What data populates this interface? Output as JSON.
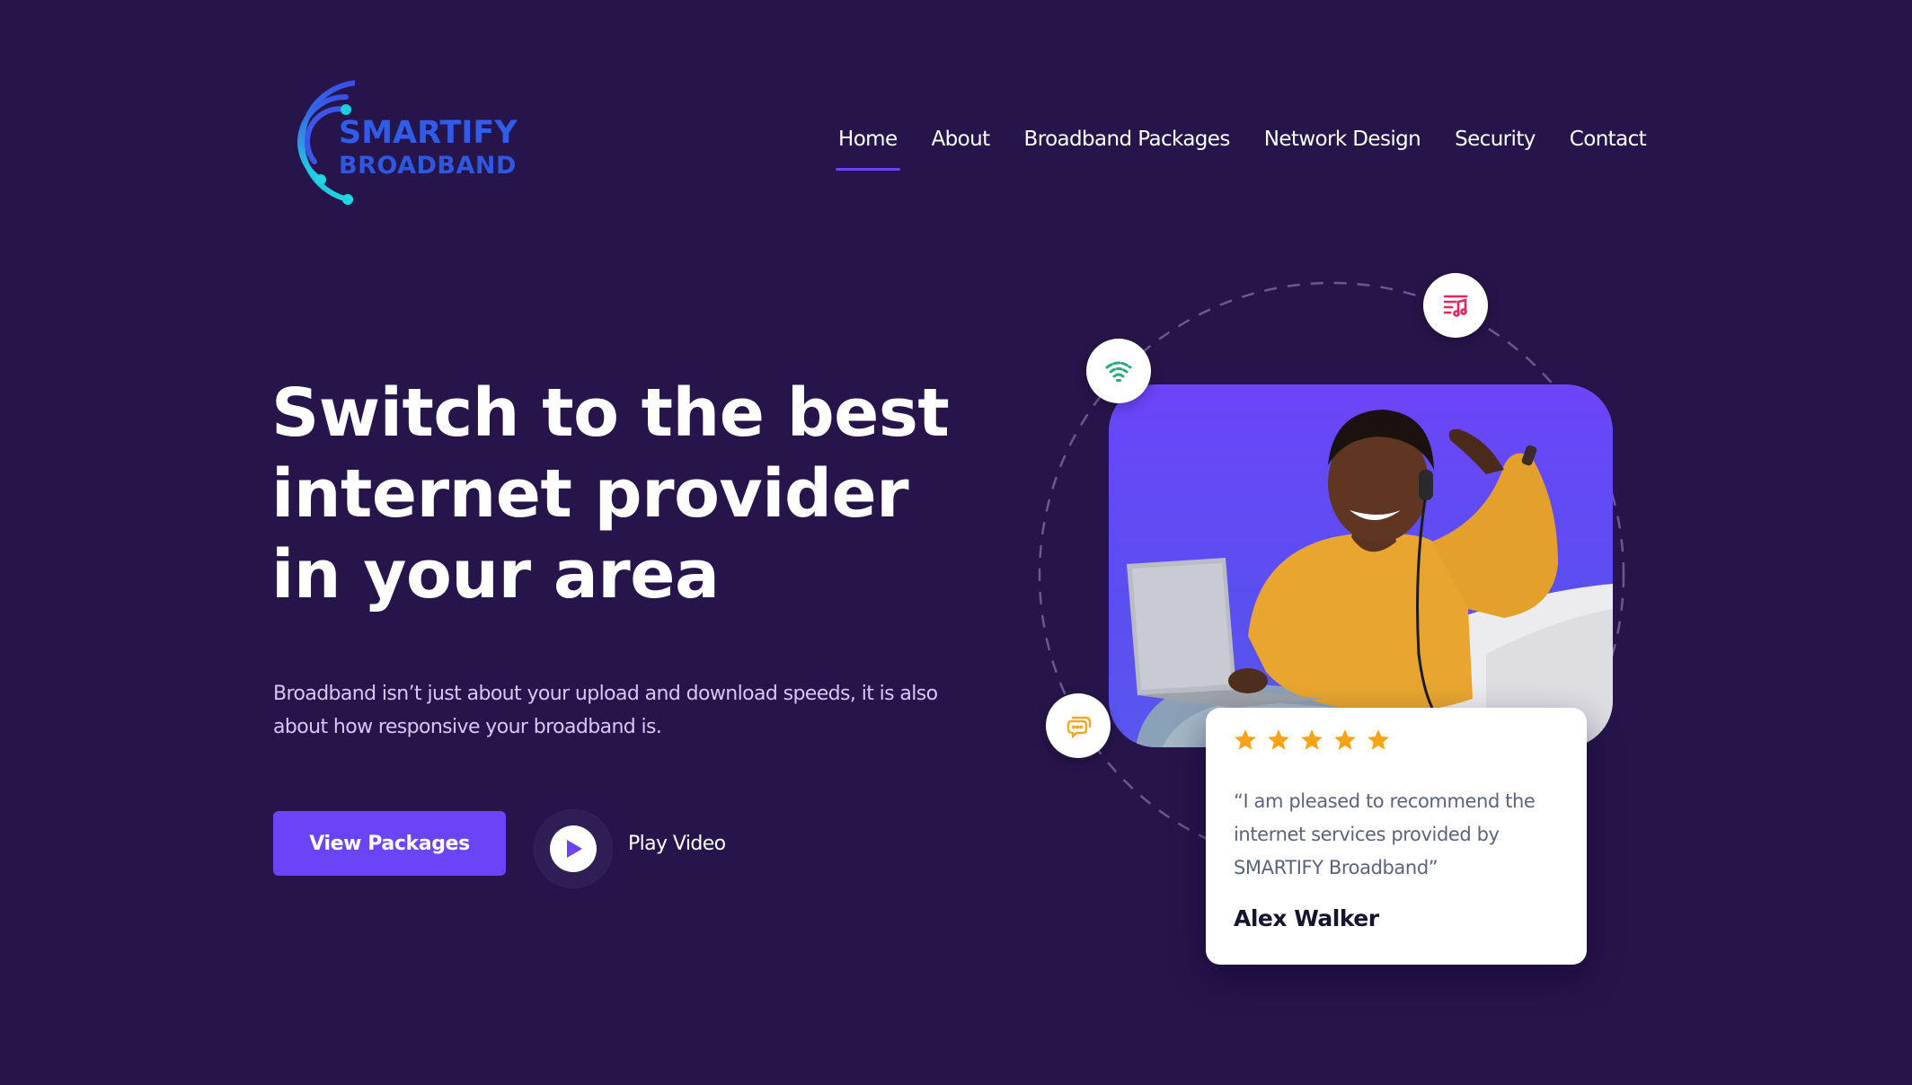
{
  "brand": {
    "line1": "SMARTIFY",
    "line2": "BROADBAND",
    "logo_icon": "signal-arcs-icon",
    "colors": {
      "primary": "#2f5ce8",
      "accent": "#22d3e6"
    }
  },
  "nav": {
    "items": [
      {
        "label": "Home",
        "active": true
      },
      {
        "label": "About",
        "active": false
      },
      {
        "label": "Broadband Packages",
        "active": false
      },
      {
        "label": "Network Design",
        "active": false
      },
      {
        "label": "Security",
        "active": false
      },
      {
        "label": "Contact",
        "active": false
      }
    ]
  },
  "hero": {
    "headline_lines": [
      "Switch to the best",
      "internet provider",
      "in your area"
    ],
    "subtext": "Broadband isn’t just about your upload and download speeds, it is also about how responsive your broadband is.",
    "cta_label": "View Packages",
    "play_label": "Play Video",
    "play_icon": "play-icon"
  },
  "visual": {
    "bubbles": [
      {
        "icon": "wifi-icon",
        "color": "#2eaa78"
      },
      {
        "icon": "music-playlist-icon",
        "color": "#e8245a"
      },
      {
        "icon": "chat-bubbles-icon",
        "color": "#f5a623"
      }
    ],
    "photo_alt": "Smiling man with headphones using a laptop on a sofa"
  },
  "testimonial": {
    "rating": 5,
    "rating_max": 5,
    "star_color": "#f7a314",
    "quote": "“I am pleased to recommend the internet services provided by SMARTIFY Broadband”",
    "author": "Alex Walker"
  },
  "theme": {
    "background": "#26154a",
    "accent": "#6a45f8"
  }
}
